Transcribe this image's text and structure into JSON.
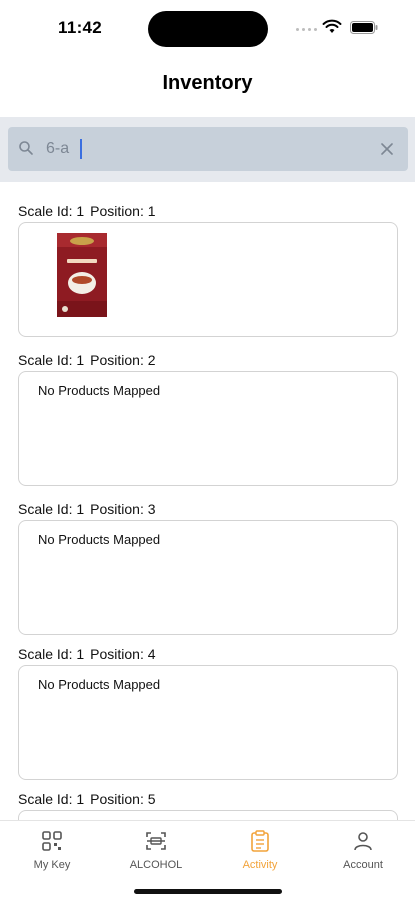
{
  "status_bar": {
    "time": "11:42"
  },
  "header": {
    "title": "Inventory"
  },
  "search": {
    "value": "6-a",
    "placeholder": ""
  },
  "slots": [
    {
      "scale_label": "Scale Id: 1",
      "position_label": "Position: 1",
      "product": "yogi-tea-classic-box",
      "product_brand": "Yogi Tea",
      "product_name": "Classic",
      "empty_text": ""
    },
    {
      "scale_label": "Scale Id: 1",
      "position_label": "Position: 2",
      "empty_text": "No Products Mapped"
    },
    {
      "scale_label": "Scale Id: 1",
      "position_label": "Position: 3",
      "empty_text": "No Products Mapped"
    },
    {
      "scale_label": "Scale Id: 1",
      "position_label": "Position: 4",
      "empty_text": "No Products Mapped"
    },
    {
      "scale_label": "Scale Id: 1",
      "position_label": "Position: 5",
      "empty_text": ""
    }
  ],
  "tabs": [
    {
      "label": "My Key",
      "icon": "qr-grid-icon",
      "active": false
    },
    {
      "label": "ALCOHOL",
      "icon": "scan-frame-icon",
      "active": false
    },
    {
      "label": "Activity",
      "icon": "clipboard-icon",
      "active": true
    },
    {
      "label": "Account",
      "icon": "person-icon",
      "active": false
    }
  ],
  "colors": {
    "accent": "#f2a33a",
    "search_bg": "#c7d0da",
    "search_area_bg": "#e6e9ee"
  }
}
